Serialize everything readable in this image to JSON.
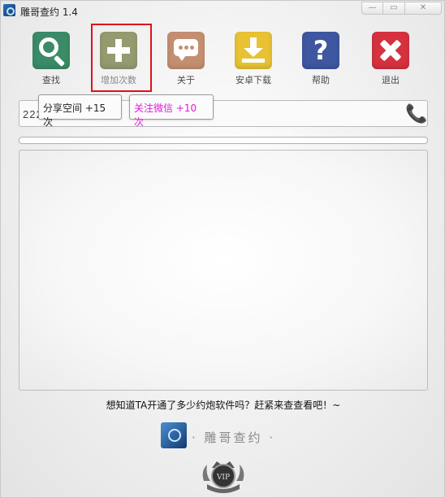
{
  "window": {
    "title": "雕哥查约 1.4"
  },
  "toolbar": {
    "search": "查找",
    "add": "增加次数",
    "about": "关于",
    "android": "安卓下载",
    "help": "帮助",
    "exit": "退出"
  },
  "input": {
    "value": "2222132132"
  },
  "chips": {
    "qzone": "分享空间 +15 次",
    "wechat": "关注微信 +10 次"
  },
  "progress": {
    "fraction": 0
  },
  "tagline": "想知道TA开通了多少约炮软件吗？赶紧来查查看吧！~",
  "footer": {
    "brand": "· 雕哥查约 ·",
    "badge": "VIP"
  },
  "colors": {
    "highlight": "#e0101a",
    "wechat_text": "#e01ad8"
  }
}
